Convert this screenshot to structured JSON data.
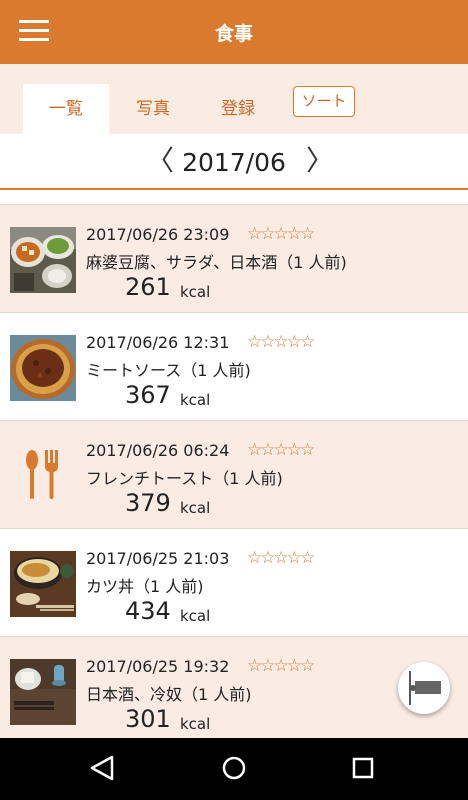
{
  "appbar": {
    "title": "食事"
  },
  "tabs": [
    {
      "label": "一覧",
      "active": true
    },
    {
      "label": "写真",
      "active": false
    },
    {
      "label": "登録",
      "active": false
    }
  ],
  "sort_label": "ソート",
  "month": {
    "label": "2017/06",
    "prev": "〈",
    "next": "〉"
  },
  "stars": "☆☆☆☆☆",
  "unit": "kcal",
  "meals": [
    {
      "time": "2017/06/26 23:09",
      "name": "麻婆豆腐、サラダ、日本酒（1 人前)",
      "kcal": "261",
      "thumb": "mapo-tofu-photo"
    },
    {
      "time": "2017/06/26 12:31",
      "name": "ミートソース（1 人前)",
      "kcal": "367",
      "thumb": "meat-sauce-photo"
    },
    {
      "time": "2017/06/26 06:24",
      "name": "フレンチトースト（1 人前)",
      "kcal": "379",
      "thumb": "cutlery-icon"
    },
    {
      "time": "2017/06/25 21:03",
      "name": "カツ丼（1 人前)",
      "kcal": "434",
      "thumb": "katsudon-photo"
    },
    {
      "time": "2017/06/25 19:32",
      "name": "日本酒、冷奴（1 人前)",
      "kcal": "301",
      "thumb": "hiyayakko-photo"
    }
  ],
  "colors": {
    "accent": "#d97a2e",
    "tint": "#fbece3"
  }
}
